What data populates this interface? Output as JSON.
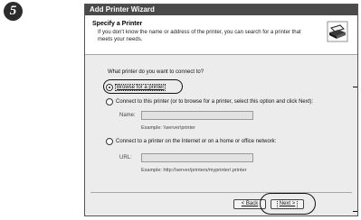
{
  "step_number": "5",
  "window": {
    "title": "Add Printer Wizard"
  },
  "header": {
    "title": "Specify a Printer",
    "subtitle": "If you don't know the name or address of the printer, you can search for a printer that meets your needs."
  },
  "question": "What printer do you want to connect to?",
  "options": {
    "browse": {
      "label": "Browse for a printer",
      "checked": true
    },
    "connect": {
      "label": "Connect to this printer (or to browse for a printer, select this option and click Next):",
      "checked": false
    },
    "internet": {
      "label": "Connect to a printer on the Internet or on a home or office network:",
      "checked": false
    }
  },
  "name_field": {
    "label": "Name:",
    "value": "",
    "example": "Example: \\\\server\\printer"
  },
  "url_field": {
    "label": "URL:",
    "value": "",
    "example": "Example: http://server/printers/myprinter/.printer"
  },
  "buttons": {
    "back": "< Back",
    "next": "Next >"
  }
}
